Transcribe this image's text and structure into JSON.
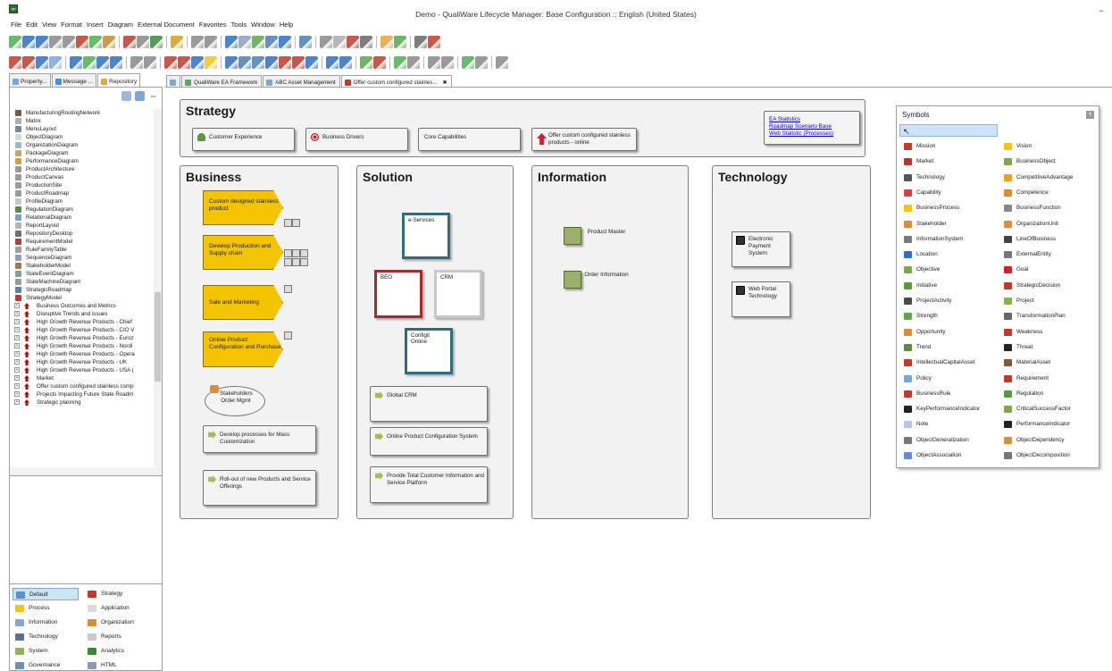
{
  "window": {
    "title": "Demo - QualiWare Lifecycle Manager: Base Configuration :: English (United States)",
    "minimize": "−",
    "app_icon": "qw"
  },
  "menu": [
    "File",
    "Edit",
    "View",
    "Format",
    "Insert",
    "Diagram",
    "External Document",
    "Favorites",
    "Tools",
    "Window",
    "Help"
  ],
  "side_tabs": [
    {
      "label": "Property...",
      "color": "#7aa7d6"
    },
    {
      "label": "Message ...",
      "color": "#4a90d9"
    },
    {
      "label": "Repository",
      "color": "#e8a33a"
    }
  ],
  "tree_items": [
    {
      "label": "ManufacturingRoutingNetwork",
      "icon": "#7d5a3c"
    },
    {
      "label": "Matrix",
      "icon": "#b0b0b0"
    },
    {
      "label": "MenuLayout",
      "icon": "#6e86a8"
    },
    {
      "label": "ObjectDiagram",
      "icon": "#d8d8d8"
    },
    {
      "label": "OrganizationDiagram",
      "icon": "#9db6d4"
    },
    {
      "label": "PackageDiagram",
      "icon": "#c9a66b"
    },
    {
      "label": "PerformanceDiagram",
      "icon": "#e0a030"
    },
    {
      "label": "ProductArchitecture",
      "icon": "#9a9a9a"
    },
    {
      "label": "ProductCanvas",
      "icon": "#9a9a9a"
    },
    {
      "label": "ProductionSite",
      "icon": "#9a9a9a"
    },
    {
      "label": "ProductRoadmap",
      "icon": "#9a9a9a"
    },
    {
      "label": "ProfileDiagram",
      "icon": "#c8c8c8"
    },
    {
      "label": "RegulationDiagram",
      "icon": "#5d8c3a"
    },
    {
      "label": "RelationalDiagram",
      "icon": "#7ba0c8"
    },
    {
      "label": "ReportLayout",
      "icon": "#b5b5b5"
    },
    {
      "label": "RepositoryDesktop",
      "icon": "#6f6f6f"
    },
    {
      "label": "RequirementModel",
      "icon": "#c0392b"
    },
    {
      "label": "RuleFamilyTable",
      "icon": "#a0a0a0"
    },
    {
      "label": "SequenceDiagram",
      "icon": "#8fa0b8"
    },
    {
      "label": "StakeholderModel",
      "icon": "#a37b4b"
    },
    {
      "label": "StateEventDiagram",
      "icon": "#7da87d"
    },
    {
      "label": "StateMachineDiagram",
      "icon": "#9a9a9a"
    },
    {
      "label": "StrategicRoadmap",
      "icon": "#5a7fb0"
    },
    {
      "label": "StrategyModel",
      "icon": "#c0392b"
    }
  ],
  "tree_children": [
    "Business Outcomes and Metrics",
    "Disruptive Trends and issues",
    "High Growth Revenue Products - Chief",
    "High Growth Revenue Products - CIO V",
    "High Growth Revenue Products - Euroz",
    "High Growth Revenue Products - Nordi",
    "High Growth Revenue Products - Opera",
    "High Growth Revenue Products - UK",
    "High Growth Revenue Products - USA (",
    "Market",
    "Offer custom configured stainless comp",
    "Projects Impacting Future State Roadm",
    "Strategic planning"
  ],
  "categories": [
    {
      "label": "Default",
      "icon": "#5b8fd0",
      "selected": true
    },
    {
      "label": "Strategy",
      "icon": "#c0392b"
    },
    {
      "label": "Process",
      "icon": "#f0c419"
    },
    {
      "label": "Application",
      "icon": "#d9d9d9"
    },
    {
      "label": "Information",
      "icon": "#8aa7c7"
    },
    {
      "label": "Organization",
      "icon": "#d98f3a"
    },
    {
      "label": "Technology",
      "icon": "#5b6f86"
    },
    {
      "label": "Reports",
      "icon": "#c9c9c9"
    },
    {
      "label": "System",
      "icon": "#8cb45a"
    },
    {
      "label": "Analytics",
      "icon": "#3a8a3a"
    },
    {
      "label": "Governance",
      "icon": "#6f8faf"
    },
    {
      "label": "HTML",
      "icon": "#8a9ab0"
    }
  ],
  "diagram_tabs": [
    {
      "label": "",
      "color": "#7aa7d6"
    },
    {
      "label": "QualiWare EA Framework",
      "color": "#4caf50"
    },
    {
      "label": "ABC Asset Management",
      "color": "#7aa7d6"
    },
    {
      "label": "Offer custom configured stainles...",
      "color": "#c0392b",
      "active": true
    }
  ],
  "diagram_tab_close": "✖",
  "strategy": {
    "title": "Strategy",
    "items": [
      "Customer Experience",
      "Business Drivers",
      "Core Capabilities",
      "Offer custom configured stainless products - online"
    ],
    "links": [
      "EA Statistics",
      "Roadmap Scenario Base",
      "Web Statistic (Processes)"
    ]
  },
  "business": {
    "title": "Business",
    "processes": [
      "Custom designed stainless product",
      "Develop Production and Supply chain",
      "Sale and Marketing",
      "Online Product Configuration and Purchase"
    ],
    "stakeholder": "Stakeholders Order Mgmt",
    "projects": [
      "Develop processes for Mass Customization",
      "Roll-out of new Products and Service Offerings"
    ]
  },
  "solution": {
    "title": "Solution",
    "systems": [
      "e-Services",
      "BEO",
      "CRM",
      "Configit Online"
    ],
    "projects": [
      "Global CRM",
      "Online Product Configuration System",
      "Provide Total Customer Information and Service Platform"
    ]
  },
  "information": {
    "title": "Information",
    "objects": [
      "Product Master",
      "Order Information"
    ]
  },
  "technology": {
    "title": "Technology",
    "items": [
      "Electronic Payment System",
      "Web Portal Technology"
    ]
  },
  "symbols": {
    "title": "Symbols",
    "close": "x",
    "pointer": "↖",
    "left": [
      "Mission",
      "Market",
      "Technology",
      "Capability",
      "BusinessProcess",
      "Stakeholder",
      "InformationSystem",
      "Location",
      "Objective",
      "Initiative",
      "ProjectActivity",
      "Strength",
      "Opportunity",
      "Trend",
      "IntellectualCapitalAsset",
      "Policy",
      "BusinessRule",
      "KeyPerformanceIndicator",
      "Note",
      "ObjectGeneralization",
      "ObjectAssociation"
    ],
    "right": [
      "Vision",
      "BusinessObject",
      "CompetitiveAdvantage",
      "Competence",
      "BusinessFunction",
      "OrganizationUnit",
      "LineOfBusiness",
      "ExternalEntity",
      "Goal",
      "StrategicDecision",
      "Project",
      "TransformationPlan",
      "Weakness",
      "Threat",
      "MaterialAsset",
      "Requirement",
      "Regulation",
      "CriticalSuccessFactor",
      "PerformanceIndicator",
      "ObjectDependency",
      "ObjectDecomposition"
    ],
    "left_colors": [
      "#c0392b",
      "#b03a2e",
      "#555555",
      "#cc4444",
      "#f0c419",
      "#d98f3a",
      "#7a7a7a",
      "#2e6fc0",
      "#7fa84a",
      "#5a9a3a",
      "#4a4a4a",
      "#5aa84a",
      "#d98f3a",
      "#5a8a3a",
      "#c0392b",
      "#7aa7d6",
      "#c0392b",
      "#222222",
      "#b0c8e0",
      "#777777",
      "#5b8fd0"
    ],
    "right_colors": [
      "#f0c419",
      "#7fa84a",
      "#f0a020",
      "#d98f3a",
      "#888888",
      "#d98f3a",
      "#444444",
      "#777777",
      "#d0202a",
      "#c0392b",
      "#8ab04a",
      "#666666",
      "#c0392b",
      "#222222",
      "#7d5a3c",
      "#c0392b",
      "#5a9a3a",
      "#7fa84a",
      "#222222",
      "#d98f3a",
      "#777777"
    ]
  }
}
